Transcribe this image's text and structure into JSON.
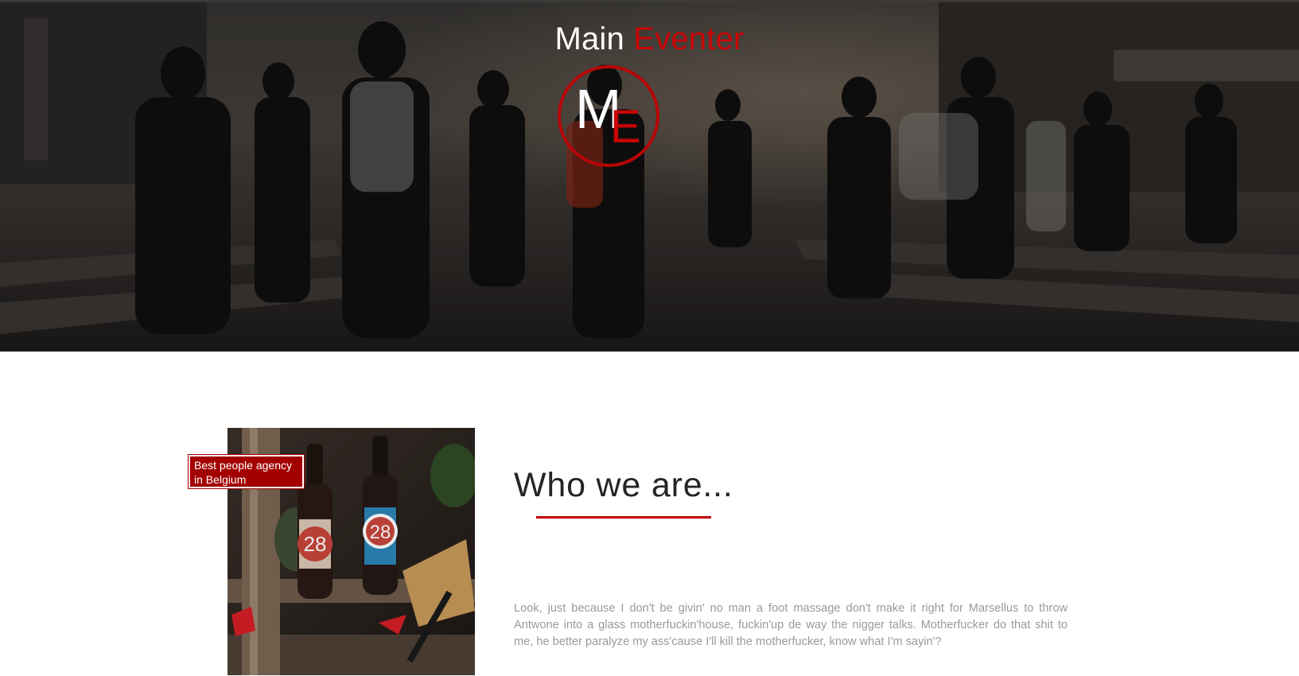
{
  "hero": {
    "brand_word_1": "Main",
    "brand_word_2": "Eventer",
    "logo_letter_1": "M",
    "logo_letter_2": "E",
    "background_image": "street-crowd-photo"
  },
  "about": {
    "badge_line_1": "Best people agency",
    "badge_line_2": "in Belgium",
    "title": "Who we are...",
    "body": "Look, just because I don't be givin' no man a foot massage don't make it right for Marsellus to throw Antwone into a glass motherfuckin'house, fuckin'up de way the nigger talks. Motherfucker do that shit to me, he better paralyze my ass'cause I'll kill the motherfucker, know what I'm sayin'?",
    "photo": "beer-bottles-photo",
    "photo_bottle_label": "28"
  },
  "colors": {
    "accent": "#c80505",
    "badge": "#a30000",
    "heading": "#252525",
    "body_text": "#9a9a9a"
  }
}
